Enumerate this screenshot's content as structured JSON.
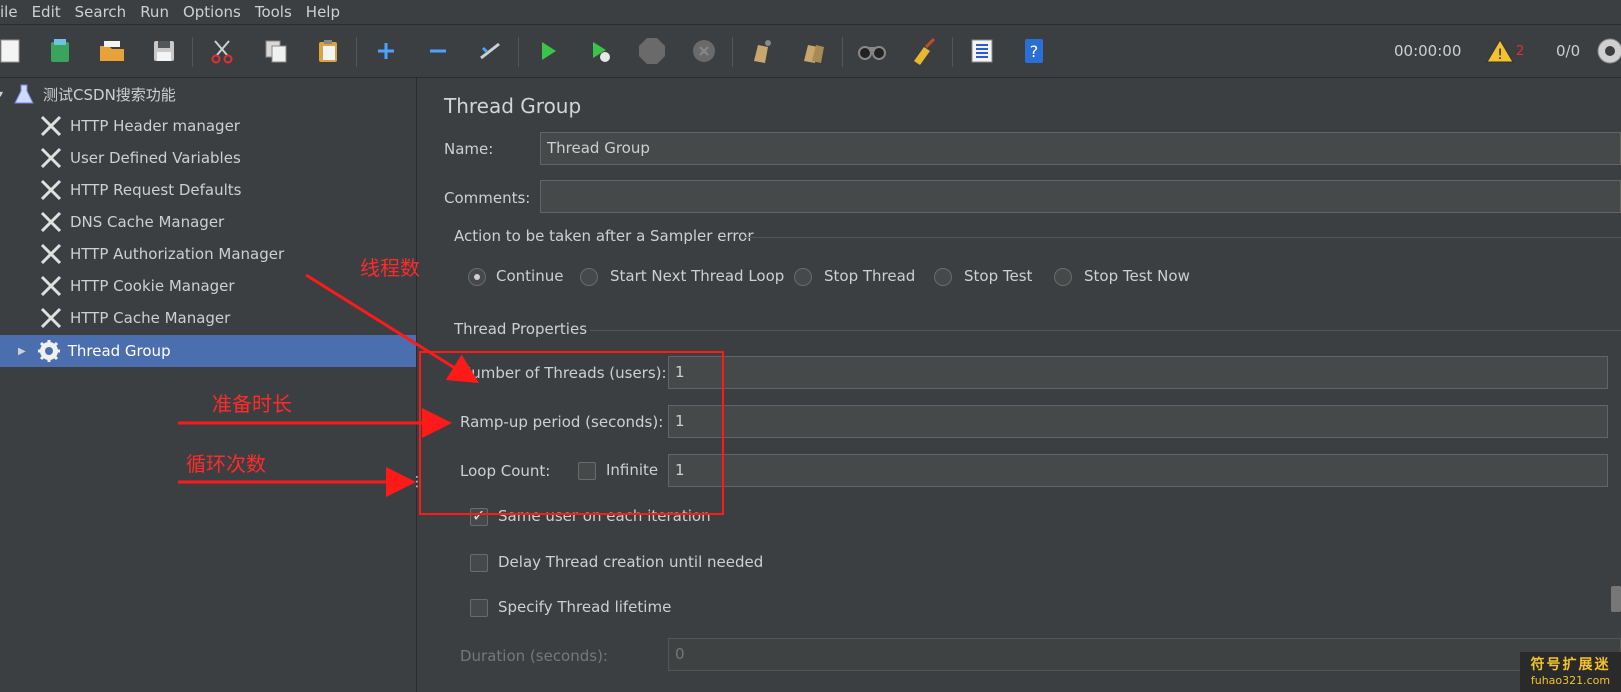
{
  "menu": [
    "ile",
    "Edit",
    "Search",
    "Run",
    "Options",
    "Tools",
    "Help"
  ],
  "toolbar": {
    "elapsed": "00:00:00",
    "warning_count": "2",
    "threads": "0/0",
    "icons": [
      "new-icon",
      "templates-icon",
      "open-icon",
      "save-icon",
      "cut-icon",
      "copy-icon",
      "paste-icon",
      "expand-icon",
      "collapse-icon",
      "toggle-icon",
      "start-icon",
      "start-no-pauses-icon",
      "stop-icon",
      "shutdown-icon",
      "clear-icon",
      "clear-all-icon",
      "search-icon",
      "reset-search-icon",
      "function-helper-icon",
      "help-icon",
      "warning-icon",
      "remote-icon"
    ]
  },
  "tree": {
    "root": "测试CSDN搜索功能",
    "items": [
      "HTTP Header manager",
      "User Defined Variables",
      "HTTP Request Defaults",
      "DNS Cache Manager",
      "HTTP Authorization Manager",
      "HTTP Cookie Manager",
      "HTTP Cache Manager"
    ],
    "selected": "Thread Group"
  },
  "panel": {
    "title": "Thread Group",
    "name_label": "Name:",
    "name_value": "Thread Group",
    "comments_label": "Comments:",
    "comments_value": "",
    "error_action_title": "Action to be taken after a Sampler error",
    "error_actions": [
      "Continue",
      "Start Next Thread Loop",
      "Stop Thread",
      "Stop Test",
      "Stop Test Now"
    ],
    "error_action_selected": "Continue",
    "thread_props_title": "Thread Properties",
    "threads_label": "Number of Threads (users):",
    "threads_value": "1",
    "rampup_label": "Ramp-up period (seconds):",
    "rampup_value": "1",
    "loop_label": "Loop Count:",
    "infinite_label": "Infinite",
    "infinite_checked": false,
    "loop_value": "1",
    "same_user_label": "Same user on each iteration",
    "same_user_checked": true,
    "delay_label": "Delay Thread creation until needed",
    "delay_checked": false,
    "lifetime_label": "Specify Thread lifetime",
    "lifetime_checked": false,
    "duration_label": "Duration (seconds):",
    "duration_value": "0"
  },
  "annotations": {
    "threads": "线程数",
    "rampup": "准备时长",
    "loops": "循环次数"
  },
  "watermark": {
    "cn": "符号扩展迷",
    "url": "fuhao321.com"
  }
}
